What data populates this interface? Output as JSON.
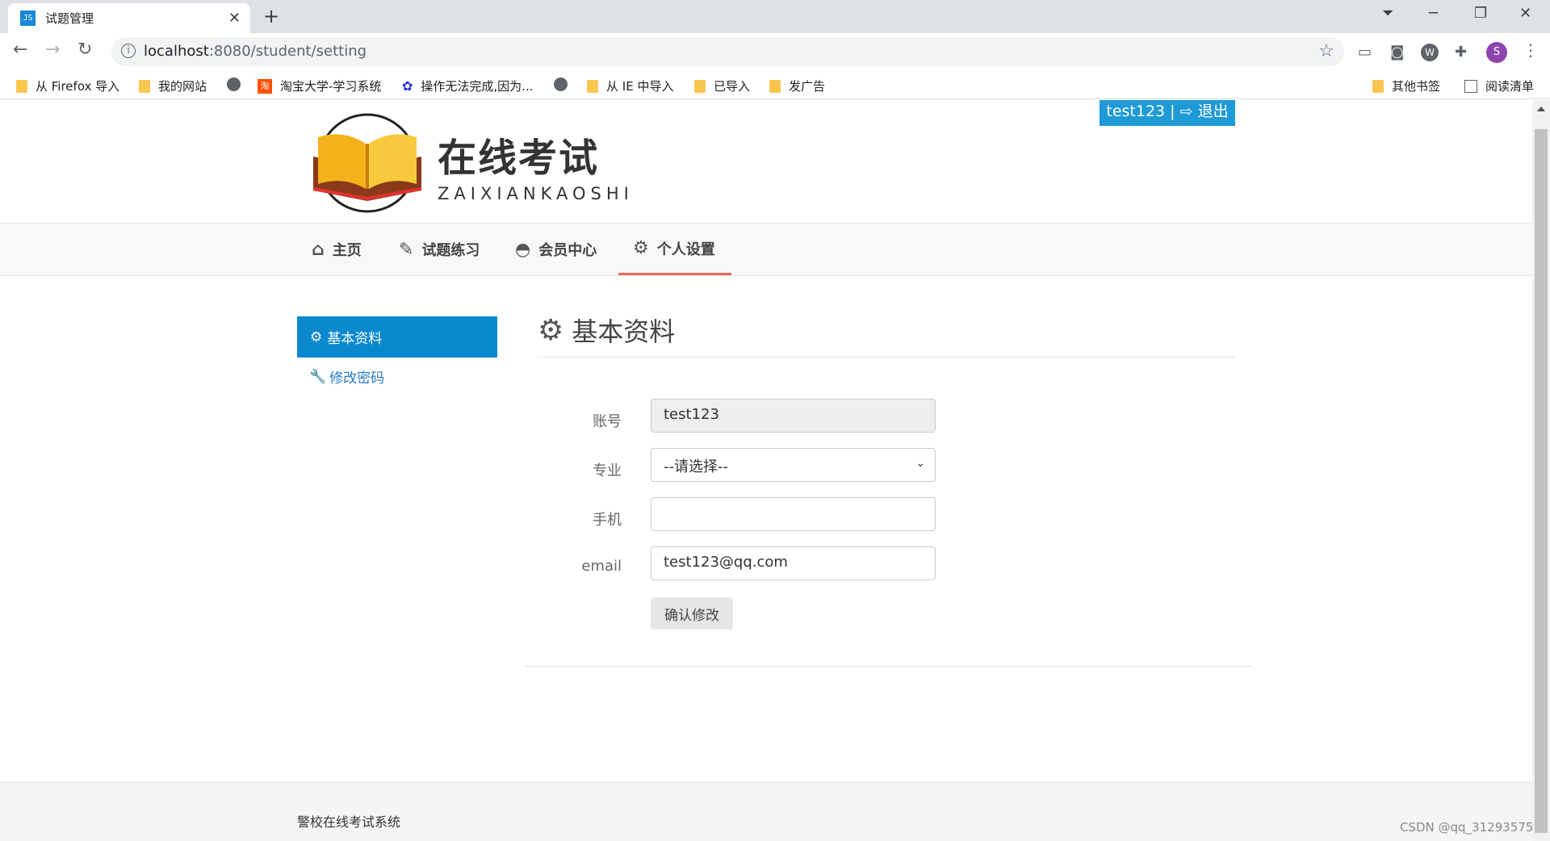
{
  "browser": {
    "tab_title": "试题管理",
    "tab_favicon": "JS",
    "url_host": "localhost",
    "url_rest": ":8080/student/setting",
    "bookmarks": [
      "从 Firefox 导入",
      "我的网站",
      "淘宝大学-学习系统",
      "操作无法完成,因为...",
      "从 IE 中导入",
      "已导入",
      "发广告"
    ],
    "other_bookmarks": "其他书签",
    "reading_list": "阅读清单",
    "profile_initial": "S"
  },
  "header": {
    "user_bar": "test123 | ⇨ 退出",
    "brand_cn": "在线考试",
    "brand_en": "ZAIXIANKAOSHI"
  },
  "nav": {
    "items": [
      "主页",
      "试题练习",
      "会员中心",
      "个人设置"
    ],
    "active": "个人设置"
  },
  "sidebar": {
    "items": [
      "基本资料",
      "修改密码"
    ]
  },
  "section": {
    "title": "基本资料"
  },
  "form": {
    "account_label": "账号",
    "account_value": "test123",
    "major_label": "专业",
    "major_selected": "--请选择--",
    "phone_label": "手机",
    "phone_value": "",
    "email_label": "email",
    "email_value": "test123@qq.com",
    "submit_label": "确认修改"
  },
  "footer": {
    "text": "警校在线考试系统"
  },
  "watermark": "CSDN @qq_31293575",
  "colors": {
    "accent_blue": "#1e9ad6",
    "sidebar_active": "#0a89cf",
    "nav_underline": "#e8685a"
  }
}
